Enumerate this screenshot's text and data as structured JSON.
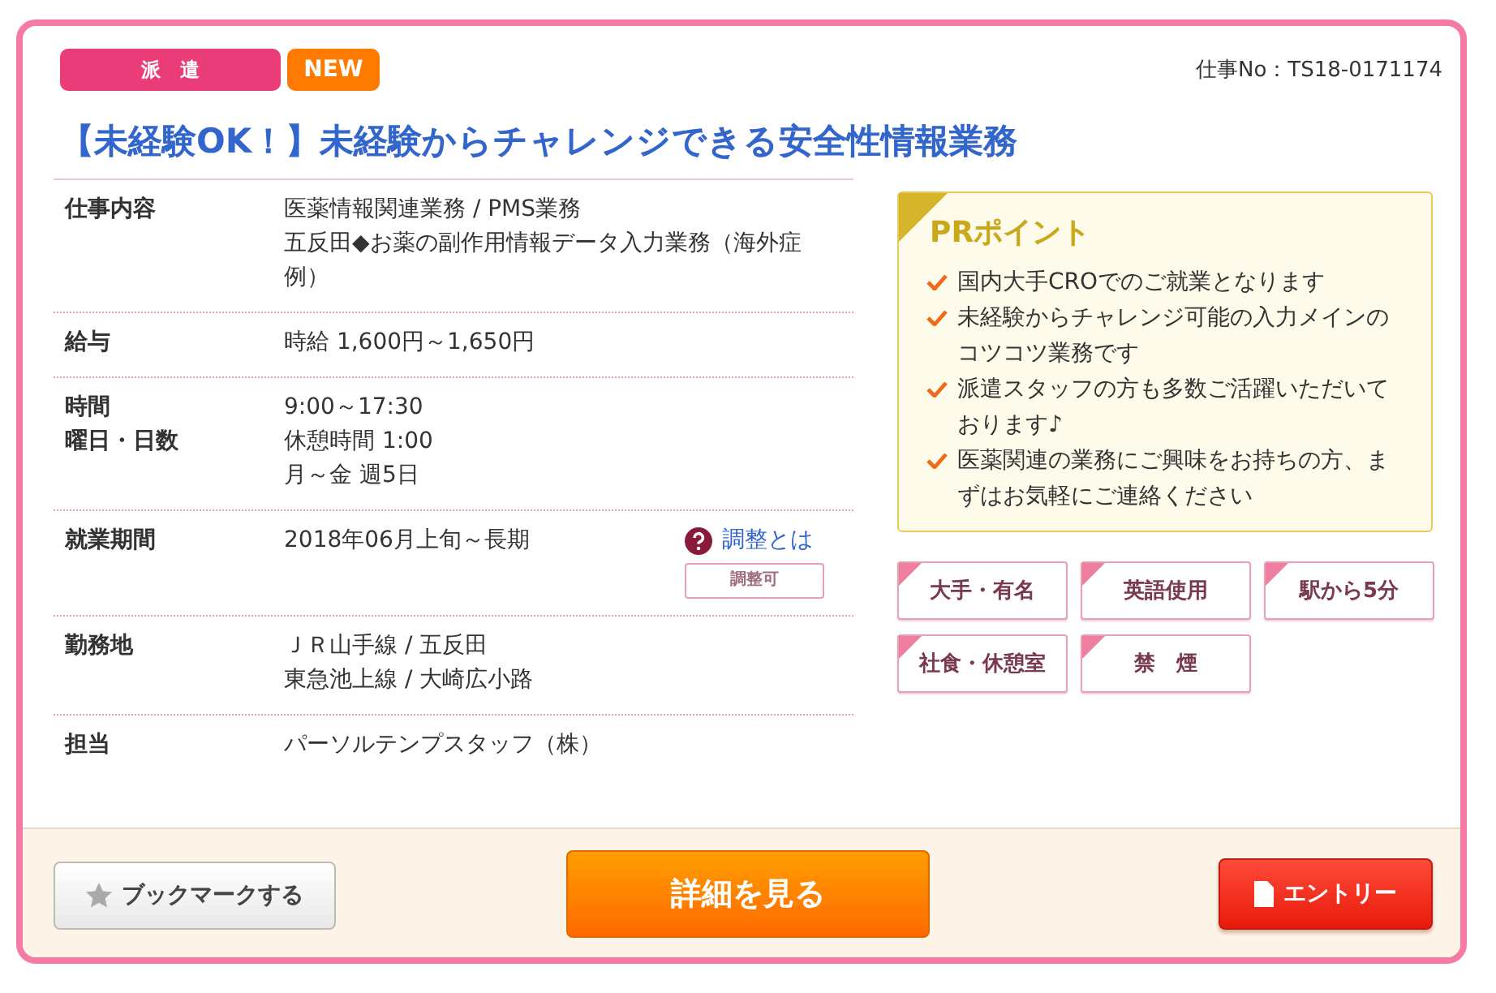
{
  "badges": [
    {
      "label": "派　遣",
      "kind": "type"
    },
    {
      "label": "NEW",
      "kind": "new"
    }
  ],
  "job_number": "仕事No：TS18-0171174",
  "title": "【未経験OK！】未経験からチャレンジできる安全性情報業務",
  "details": [
    {
      "labels": [
        "仕事内容"
      ],
      "lines": [
        "医薬情報関連業務 / PMS業務",
        "五反田◆お薬の副作用情報データ入力業務（海外症例）"
      ]
    },
    {
      "labels": [
        "給与"
      ],
      "lines": [
        "時給 1,600円～1,650円"
      ]
    },
    {
      "labels": [
        "時間",
        "曜日・日数"
      ],
      "lines": [
        "9:00～17:30",
        "休憩時間 1:00",
        "月～金 週5日"
      ]
    },
    {
      "labels": [
        "就業期間"
      ],
      "lines": [
        "2018年06月上旬～長期"
      ],
      "help_link": "調整とは",
      "note_tag": "調整可"
    },
    {
      "labels": [
        "勤務地"
      ],
      "lines": [
        "ＪＲ山手線 / 五反田",
        "東急池上線 / 大崎広小路"
      ]
    },
    {
      "labels": [
        "担当"
      ],
      "lines": [
        "パーソルテンプスタッフ（株）"
      ]
    }
  ],
  "pr": {
    "title": "PRポイント",
    "points": [
      "国内大手CROでのご就業となります",
      "未経験からチャレンジ可能の入力メインのコツコツ業務です",
      "派遣スタッフの方も多数ご活躍いただいております♪",
      "医薬関連の業務にご興味をお持ちの方、まずはお気軽にご連絡ください"
    ]
  },
  "tags": [
    "大手・有名",
    "英語使用",
    "駅から5分",
    "社食・休憩室",
    "禁　煙"
  ],
  "actions": [
    {
      "label": "ブックマークする",
      "kind": "bookmark"
    },
    {
      "label": "詳細を見る",
      "kind": "detail"
    },
    {
      "label": "エントリー",
      "kind": "entry"
    }
  ]
}
